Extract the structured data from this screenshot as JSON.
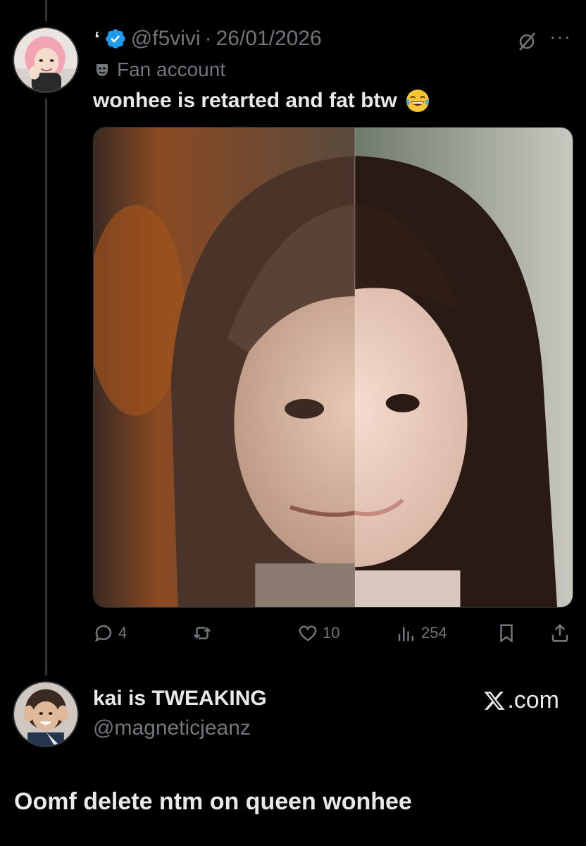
{
  "quoted_tweet": {
    "author_prefix": "‘",
    "handle": "@f5vivi",
    "separator": "·",
    "date": "26/01/2026",
    "label": "Fan account",
    "text": "wonhee is retarted and fat btw",
    "emoji": "face-with-tears-of-joy",
    "icons": {
      "verified": "verified-badge-icon",
      "grok": "grok-icon",
      "more": "more-icon"
    },
    "actions": {
      "reply_count": "4",
      "repost_count": "",
      "like_count": "10",
      "view_count": "254"
    }
  },
  "quoting_tweet": {
    "display_name": "kai is TWEAKING",
    "handle": "@magneticjeanz",
    "brand": ".com",
    "text": "Oomf delete ntm on queen wonhee"
  },
  "colors": {
    "background": "#000000",
    "text_primary": "#e7e9ea",
    "text_secondary": "#71767b",
    "verified_blue": "#1d9bf0"
  }
}
